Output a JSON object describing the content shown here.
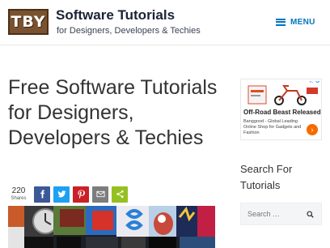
{
  "header": {
    "logo_text": "TBY",
    "site_title": "Software Tutorials",
    "tagline": "for Designers, Developers & Techies",
    "menu_label": "MENU"
  },
  "main": {
    "page_title": "Free Software Tutorials for Designers, Developers & Techies",
    "share": {
      "count": "220",
      "count_label": "Shares",
      "buttons": [
        {
          "icon": "facebook-icon",
          "color": "#3b5998"
        },
        {
          "icon": "twitter-icon",
          "color": "#1da1f2"
        },
        {
          "icon": "pinterest-icon",
          "color": "#cb2027"
        },
        {
          "icon": "email-icon",
          "color": "#7d7d7d"
        },
        {
          "icon": "share-icon",
          "color": "#95c11f"
        }
      ]
    }
  },
  "sidebar": {
    "ad": {
      "close_label": "▷✕",
      "headline": "Off-Road Beast Released",
      "body": "Banggood - Global Leading Online Shop for Gadgets and Fashion",
      "cta_icon": "arrow-right-icon"
    },
    "search_widget": {
      "title": "Search For Tutorials",
      "placeholder": "Search …"
    }
  },
  "colors": {
    "accent": "#0274be",
    "title": "#1b2336",
    "logo_bg": "#7a5230"
  }
}
